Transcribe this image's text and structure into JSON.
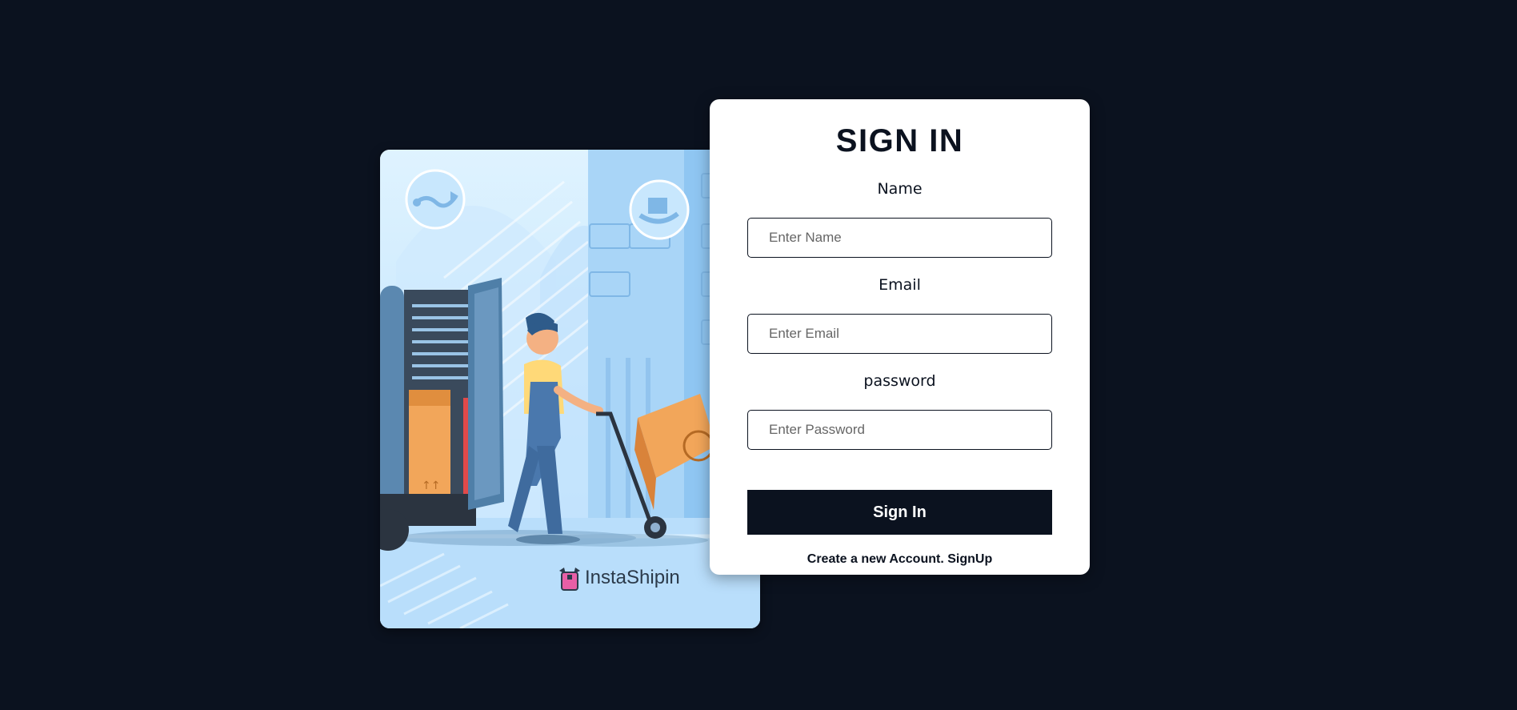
{
  "illustration": {
    "brand_name": "InstaShipin",
    "icons": [
      "map-route-icon",
      "delivery-hand-icon",
      "shopping-bag-logo-icon"
    ]
  },
  "signin": {
    "title": "SIGN IN",
    "name_label": "Name",
    "name_placeholder": "Enter Name",
    "email_label": "Email",
    "email_placeholder": "Enter Email",
    "password_label": "password",
    "password_placeholder": "Enter Password",
    "button_label": "Sign In",
    "signup_prefix": "Create a new Account.",
    "signup_link": "SignUp"
  },
  "colors": {
    "page_background": "#0b121f",
    "card_background": "#ffffff",
    "accent": "#0b121f",
    "illustration_sky": "#bfe3fb"
  }
}
